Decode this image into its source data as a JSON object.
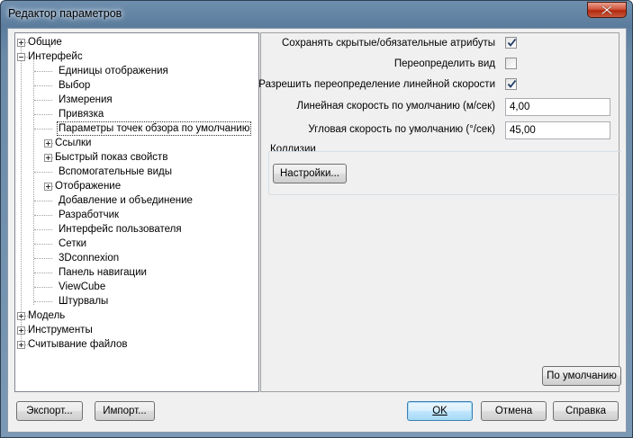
{
  "window": {
    "title": "Редактор параметров"
  },
  "tree": {
    "items": [
      {
        "label": "Общие",
        "expander": "plus"
      },
      {
        "label": "Интерфейс",
        "expander": "minus"
      },
      {
        "label": "Единицы отображения"
      },
      {
        "label": "Выбор"
      },
      {
        "label": "Измерения"
      },
      {
        "label": "Привязка"
      },
      {
        "label": "Параметры точек обзора по умолчанию",
        "selected": true
      },
      {
        "label": "Ссылки",
        "expander": "plus"
      },
      {
        "label": "Быстрый показ свойств",
        "expander": "plus"
      },
      {
        "label": "Вспомогательные виды"
      },
      {
        "label": "Отображение",
        "expander": "plus"
      },
      {
        "label": "Добавление и объединение"
      },
      {
        "label": "Разработчик"
      },
      {
        "label": "Интерфейс пользователя"
      },
      {
        "label": "Сетки"
      },
      {
        "label": "3Dconnexion"
      },
      {
        "label": "Панель навигации"
      },
      {
        "label": "ViewCube"
      },
      {
        "label": "Штурвалы"
      },
      {
        "label": "Модель",
        "expander": "plus"
      },
      {
        "label": "Инструменты",
        "expander": "plus"
      },
      {
        "label": "Считывание файлов",
        "expander": "plus"
      }
    ]
  },
  "settings": {
    "keep_hidden_attrs": {
      "label": "Сохранять скрытые/обязательные атрибуты",
      "checked": true
    },
    "override_view": {
      "label": "Переопределить вид",
      "checked": false
    },
    "allow_linear_override": {
      "label": "Разрешить переопределение линейной скорости",
      "checked": true
    },
    "linear_speed": {
      "label": "Линейная скорость по умолчанию (м/сек)",
      "value": "4,00"
    },
    "angular_speed": {
      "label": "Угловая скорость по умолчанию (°/сек)",
      "value": "45,00"
    },
    "collisions": {
      "group_label": "Коллизии",
      "settings_button": "Настройки..."
    },
    "defaults_button": "По умолчанию"
  },
  "footer": {
    "export_button": "Экспорт...",
    "import_button": "Импорт...",
    "ok_button": "OK",
    "cancel_button": "Отмена",
    "help_button": "Справка"
  },
  "colors": {
    "accent": "#3c7fb1",
    "titlebar": "#5b7c9c",
    "close": "#c8452a"
  }
}
